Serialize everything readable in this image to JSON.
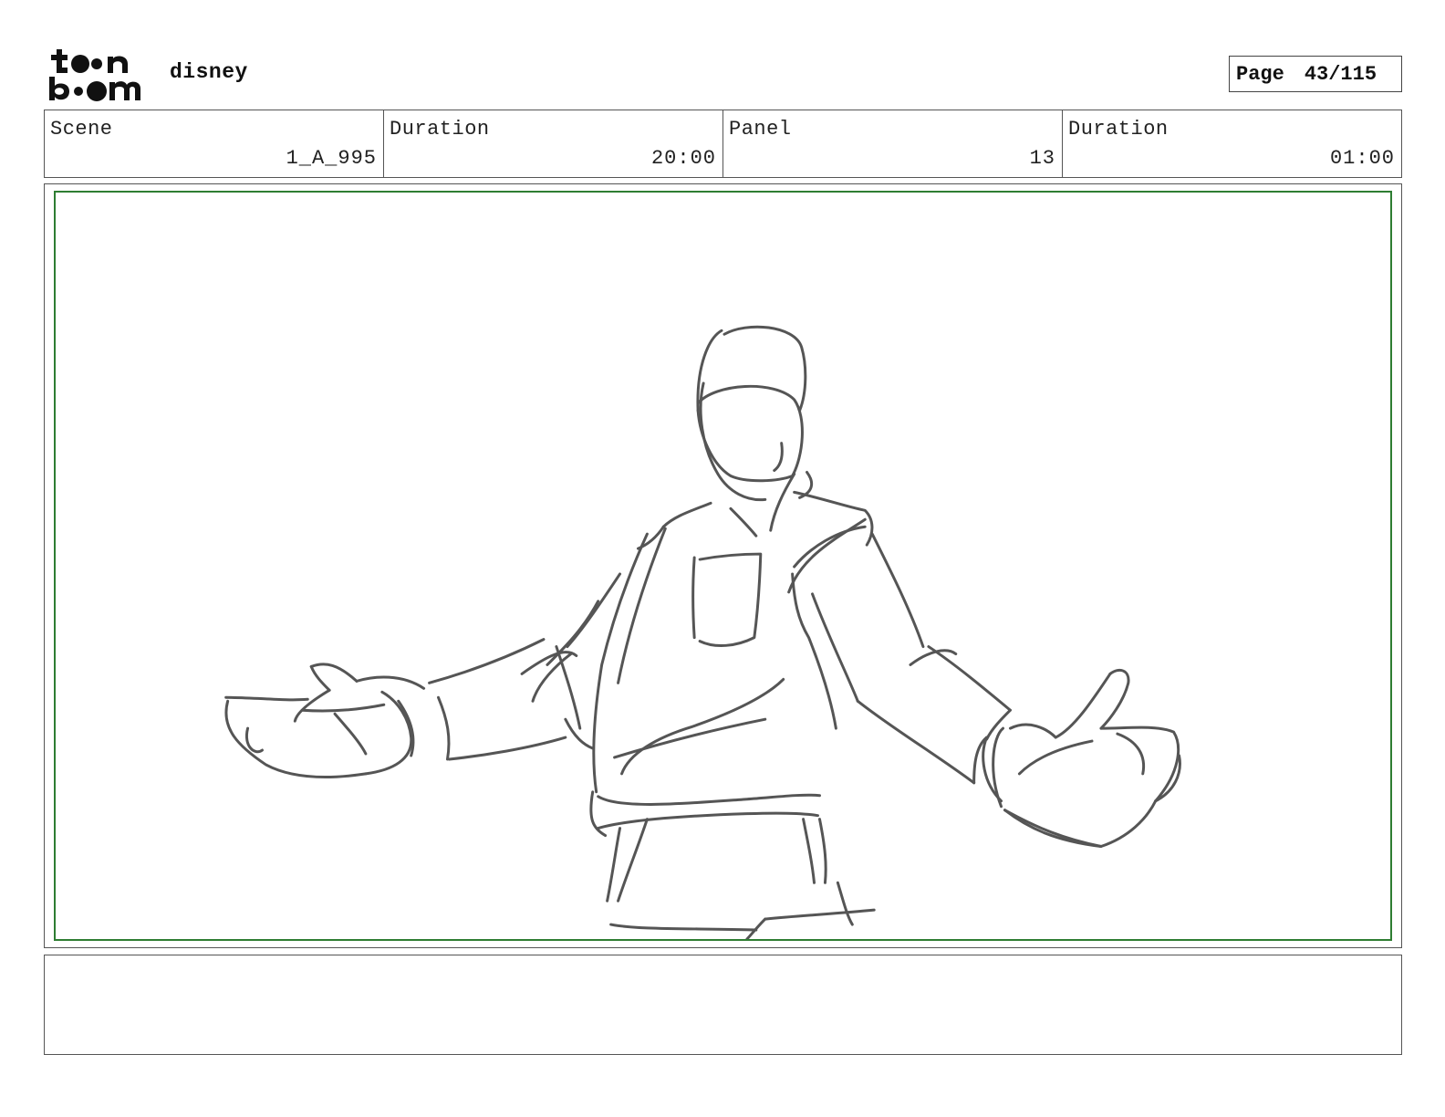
{
  "header": {
    "logo_text": "toon boom",
    "studio": "disney",
    "page_label": "Page",
    "page_number": "43/115"
  },
  "info": {
    "scene_label": "Scene",
    "scene_value": "1_A_995",
    "scene_duration_label": "Duration",
    "scene_duration_value": "20:00",
    "panel_label": "Panel",
    "panel_value": "13",
    "panel_duration_label": "Duration",
    "panel_duration_value": "01:00"
  },
  "panel": {
    "frame_color": "#2e7d32",
    "stroke_color": "#555555"
  },
  "notes": {
    "text": ""
  }
}
